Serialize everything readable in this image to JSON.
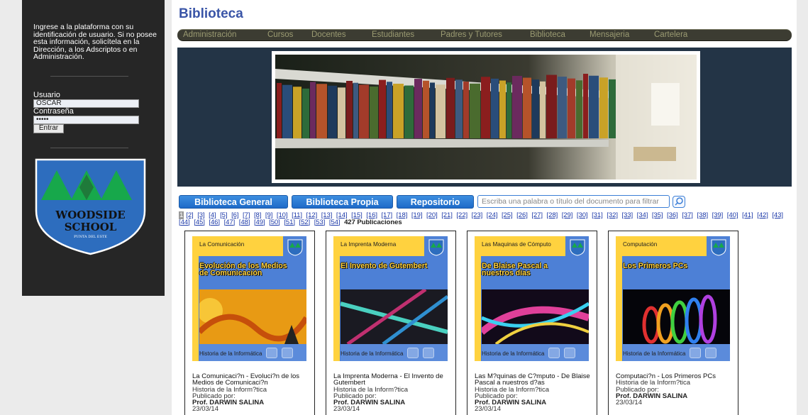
{
  "sidebar": {
    "intro": "Ingrese a la plataforma con su identificación de usuario. Si no posee esta información, solicítela en la Dirección, a los Adscriptos o en Administración.",
    "username_label": "Usuario",
    "username_value": "OSCAR",
    "password_label": "Contraseña",
    "password_value": "•••••",
    "submit_label": "Entrar",
    "logo": {
      "name": "WOODSIDE",
      "name2": "SCHOOL",
      "subtitle": "PUNTA DEL ESTE"
    }
  },
  "page": {
    "title": "Biblioteca"
  },
  "nav": [
    "Administración",
    "Cursos",
    "Docentes",
    "Estudiantes",
    "Padres y Tutores",
    "Biblioteca",
    "Mensajeria",
    "Cartelera"
  ],
  "tabs": [
    "Biblioteca General",
    "Biblioteca Propia",
    "Repositorio"
  ],
  "search": {
    "placeholder": "Escriba una palabra o título del documento para filtrar"
  },
  "pager": {
    "current": "1",
    "pages": [
      "[2]",
      "[3]",
      "[4]",
      "[5]",
      "[6]",
      "[7]",
      "[8]",
      "[9]",
      "[10]",
      "[11]",
      "[12]",
      "[13]",
      "[14]",
      "[15]",
      "[16]",
      "[17]",
      "[18]",
      "[19]",
      "[20]",
      "[21]",
      "[22]",
      "[23]",
      "[24]",
      "[25]",
      "[26]",
      "[27]",
      "[28]",
      "[29]",
      "[30]",
      "[31]",
      "[32]",
      "[33]",
      "[34]",
      "[35]",
      "[36]",
      "[37]",
      "[38]",
      "[39]",
      "[40]",
      "[41]",
      "[42]",
      "[43]",
      "[44]",
      "[45]",
      "[46]",
      "[47]",
      "[48]",
      "[49]",
      "[50]",
      "[51]",
      "[52]",
      "[53]",
      "[54]"
    ],
    "total": "427 Publicaciones"
  },
  "cards": [
    {
      "tag": "La Comunicación",
      "cover_title": "Evolución de los Medios de Comunicación",
      "footer": "Historia de la Informática",
      "title": "La Comunicaci?n - Evoluci?n de los Medios de Comunicaci?n",
      "subject": "Historia de la Inform?tica",
      "published_by": "Publicado por:",
      "author": "Prof. DARWIN SALINA",
      "date": "23/03/14"
    },
    {
      "tag": "La Imprenta Moderna",
      "cover_title": "El Invento de Gutembert",
      "footer": "Historia de la Informática",
      "title": "La Imprenta Moderna - El Invento de Gutembert",
      "subject": "Historia de la Inform?tica",
      "published_by": "Publicado por:",
      "author": "Prof. DARWIN SALINA",
      "date": "23/03/14"
    },
    {
      "tag": "Las Maquinas de Cómputo",
      "cover_title": "De Blaise Pascal a nuestros días",
      "footer": "Historia de la Informática",
      "title": "Las M?quinas de C?mputo - De Blaise Pascal a nuestros d?as",
      "subject": "Historia de la Inform?tica",
      "published_by": "Publicado por:",
      "author": "Prof. DARWIN SALINA",
      "date": "23/03/14"
    },
    {
      "tag": "Computación",
      "cover_title": "Los Primeros PCs",
      "footer": "Historia de la Informática",
      "title": "Computaci?n - Los Primeros PCs",
      "subject": "Historia de la Inform?tica",
      "published_by": "Publicado por:",
      "author": "Prof. DARWIN SALINA",
      "date": "23/03/14"
    }
  ],
  "colors": {
    "accent_blue": "#3a55a7",
    "tab_blue": "#1e6ac8",
    "cover_blue": "#4d80d6",
    "cover_yellow": "#ffd23f",
    "sidebar_bg": "#262626",
    "nav_bg": "#3c3c32"
  }
}
